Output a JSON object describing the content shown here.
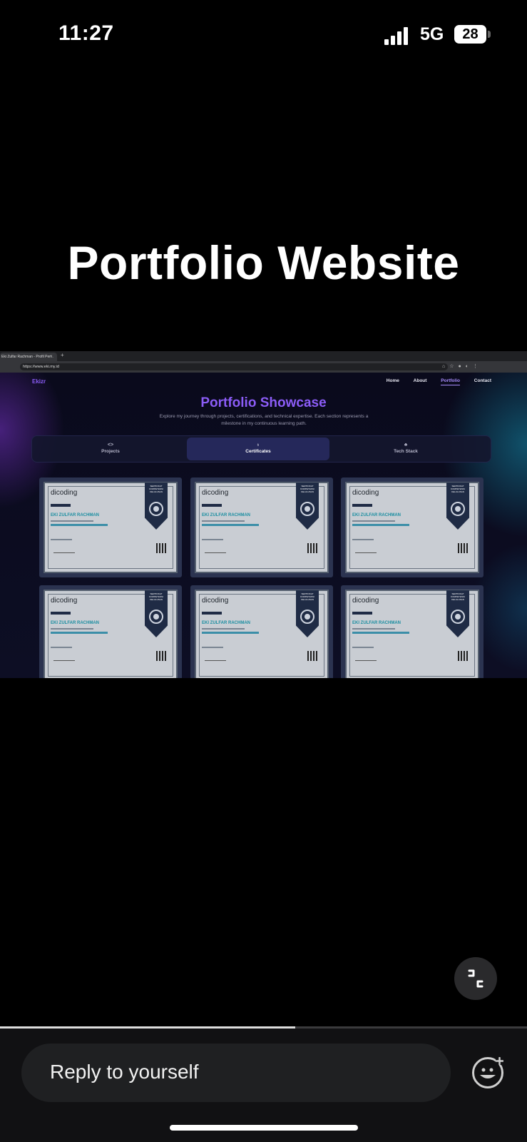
{
  "status_bar": {
    "time": "11:27",
    "network": "5G",
    "battery": "28"
  },
  "video": {
    "title": "Portfolio Website"
  },
  "browser": {
    "tab_title": "Eki Zulfar Rachman - Profil Per...",
    "tab_close": "×",
    "new_tab": "+",
    "url": "https://www.eki.my.id",
    "site": {
      "logo": "Ekizr",
      "nav": [
        "Home",
        "About",
        "Portfolio",
        "Contact"
      ],
      "active_nav": "Portfolio",
      "heading": "Portfolio Showcase",
      "description": "Explore my journey through projects, certifications, and technical expertise. Each section represents a milestone in my continuous learning path.",
      "tabs": [
        {
          "label": "Projects",
          "glyph": "<>"
        },
        {
          "label": "Certificates",
          "glyph": "♁"
        },
        {
          "label": "Tech Stack",
          "glyph": "♣"
        }
      ],
      "active_tab": "Certificates",
      "certificates": [
        {
          "logo": "dicoding",
          "ribbon": "SERTIFIKAT KOMPETENSI KELULUSAN",
          "name": "EKI ZULFAR RACHMAN"
        },
        {
          "logo": "dicoding",
          "ribbon": "SERTIFIKAT KOMPETENSI KELULUSAN",
          "name": "EKI ZULFAR RACHMAN"
        },
        {
          "logo": "dicoding",
          "ribbon": "SERTIFIKAT KOMPETENSI KELULUSAN",
          "name": "EKI ZULFAR RACHMAN"
        },
        {
          "logo": "dicoding",
          "ribbon": "SERTIFIKAT KOMPETENSI KELULUSAN",
          "name": "EKI ZULFAR RACHMAN"
        },
        {
          "logo": "dicoding",
          "ribbon": "SERTIFIKAT KOMPETENSI KELULUSAN",
          "name": "EKI ZULFAR RACHMAN"
        },
        {
          "logo": "dicoding",
          "ribbon": "SERTIFIKAT KOMPETENSI KELULUSAN",
          "name": "EKI ZULFAR RACHMAN"
        }
      ]
    }
  },
  "story_progress": 0.56,
  "reply": {
    "placeholder": "Reply to yourself"
  },
  "icons": {
    "minimize": "minimize-icon",
    "emoji": "emoji-add-icon"
  },
  "colors": {
    "accent": "#8b5cf6",
    "cert_name": "#1b8ea1",
    "panel": "#111113"
  }
}
